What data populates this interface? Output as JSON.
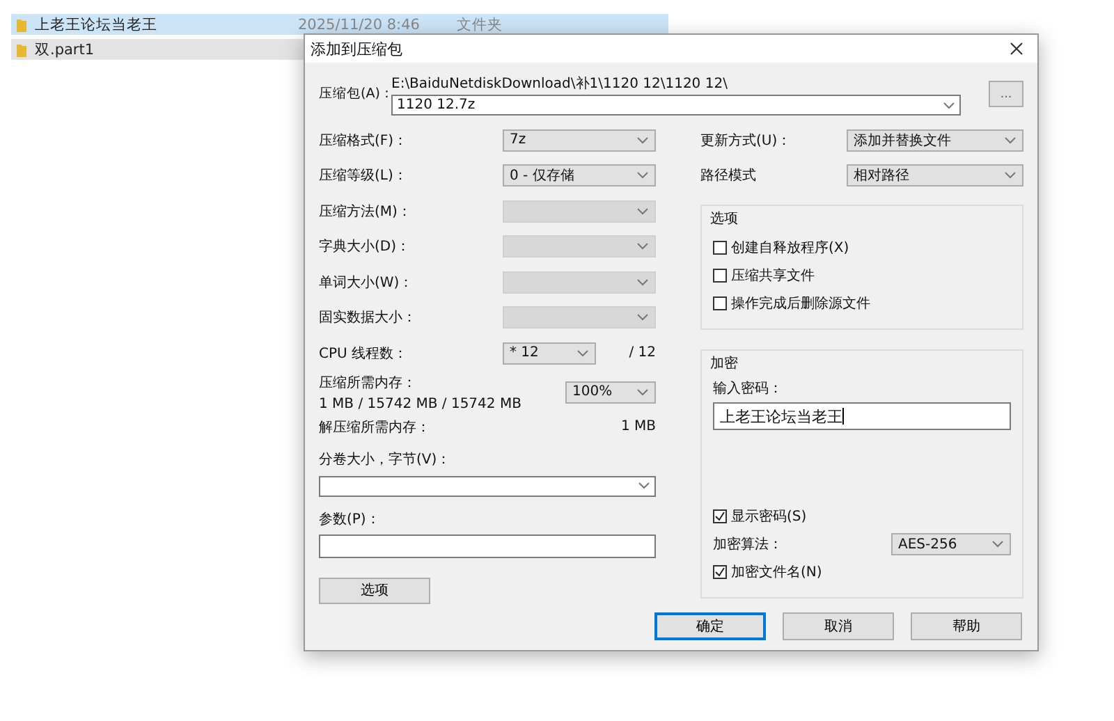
{
  "explorer": {
    "rows": [
      {
        "name": "上老王论坛当老王",
        "date": "2025/11/20 8:46",
        "type": "文件夹",
        "selected": true
      },
      {
        "name": "双.part1",
        "selected": false
      }
    ]
  },
  "dialog": {
    "title": "添加到压缩包",
    "archive": {
      "label": "压缩包(A)：",
      "path": "E:\\BaiduNetdiskDownload\\补1\\1120 12\\1120 12\\",
      "value": "1120 12.7z",
      "browse": "..."
    },
    "left_fields": [
      {
        "kind": "select",
        "label": "压缩格式(F)：",
        "value": "7z",
        "disabled": false
      },
      {
        "kind": "select",
        "label": "压缩等级(L)：",
        "value": "0 - 仅存储",
        "disabled": false
      },
      {
        "kind": "select",
        "label": "压缩方法(M)：",
        "disabled": true
      },
      {
        "kind": "select",
        "label": "字典大小(D)：",
        "disabled": true
      },
      {
        "kind": "select",
        "label": "单词大小(W)：",
        "disabled": true
      },
      {
        "kind": "select",
        "label": "固实数据大小：",
        "disabled": true
      },
      {
        "kind": "threads",
        "label": "CPU 线程数：",
        "value": "* 12",
        "note": "/ 12"
      },
      {
        "kind": "memory",
        "label": "压缩所需内存：",
        "detail": "1 MB / 15742 MB / 15742 MB",
        "value": "100%"
      },
      {
        "kind": "info",
        "label": "解压缩所需内存：",
        "note": "1 MB"
      },
      {
        "kind": "combo",
        "label": "分卷大小，字节(V)："
      },
      {
        "kind": "input",
        "label": "参数(P)："
      }
    ],
    "options_button": "选项",
    "right_fields": [
      {
        "label": "更新方式(U)：",
        "value": "添加并替换文件"
      },
      {
        "label": "路径模式",
        "value": "相对路径"
      }
    ],
    "options_group": {
      "legend": "选项",
      "checks": [
        {
          "label": "创建自释放程序(X)",
          "checked": false
        },
        {
          "label": "压缩共享文件",
          "checked": false
        },
        {
          "label": "操作完成后删除源文件",
          "checked": false
        }
      ]
    },
    "encryption": {
      "legend": "加密",
      "password_label": "输入密码：",
      "password": "上老王论坛当老王",
      "show_password": {
        "label": "显示密码(S)",
        "checked": true
      },
      "method_label": "加密算法：",
      "method": "AES-256",
      "encrypt_names": {
        "label": "加密文件名(N)",
        "checked": true
      }
    },
    "buttons": [
      {
        "label": "确定",
        "default": true
      },
      {
        "label": "取消",
        "default": false
      },
      {
        "label": "帮助",
        "default": false
      }
    ]
  }
}
